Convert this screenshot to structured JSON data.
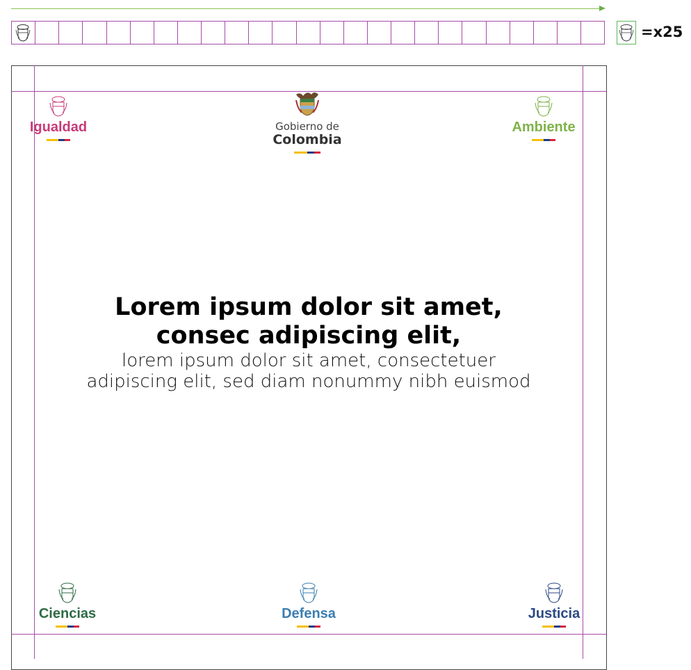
{
  "unit_label": "=x25",
  "gov_logo": {
    "line1": "Gobierno de",
    "line2": "Colombia"
  },
  "sectors": {
    "top_left": {
      "name": "Igualdad",
      "color": "#c83a78"
    },
    "top_right": {
      "name": "Ambiente",
      "color": "#7fb24a"
    },
    "bottom_left": {
      "name": "Ciencias",
      "color": "#2e6b44"
    },
    "bottom_center": {
      "name": "Defensa",
      "color": "#3b7eb0"
    },
    "bottom_right": {
      "name": "Justicia",
      "color": "#2c4a84"
    }
  },
  "headline": {
    "title_line1": "Lorem ipsum dolor sit amet,",
    "title_line2": "consec adipiscing elit,",
    "sub_line1": "lorem ipsum dolor sit amet, consectetuer",
    "sub_line2": "adipiscing elit, sed diam nonummy nibh euismod"
  },
  "colors": {
    "guide": "#a64ca6",
    "arrow": "#8cc152",
    "flag_yellow": "#f6c000",
    "flag_blue": "#1f3c88",
    "flag_red": "#d7263d"
  }
}
